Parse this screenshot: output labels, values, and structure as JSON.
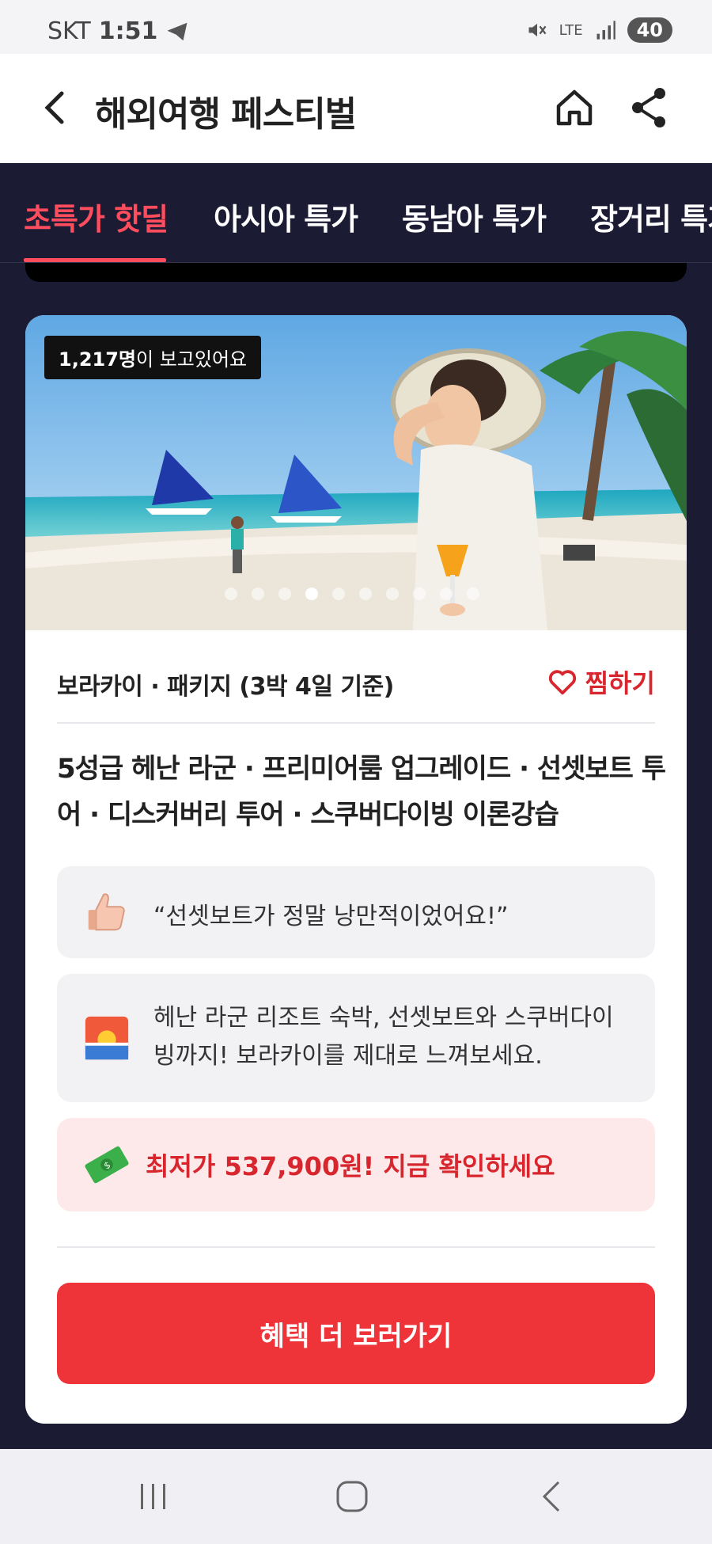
{
  "status_bar": {
    "carrier": "SKT",
    "time": "1:51",
    "network": "LTE",
    "battery": "40"
  },
  "header": {
    "title": "해외여행 페스티벌"
  },
  "tabs": [
    {
      "label": "초특가 핫딜",
      "active": true
    },
    {
      "label": "아시아 특가",
      "active": false
    },
    {
      "label": "동남아 특가",
      "active": false
    },
    {
      "label": "장거리 특가",
      "active": false
    }
  ],
  "card": {
    "viewers_count": "1,217명",
    "viewers_suffix": "이 보고있어요",
    "carousel": {
      "total": 10,
      "active_index": 3
    },
    "product_name": "보라카이 · 패키지 (3박 4일 기준)",
    "wishlist_label": "찜하기",
    "highlights": "5성급 헤난 라군 · 프리미어룸 업그레이드 · 선셋보트 투어 · 디스커버리 투어 · 스쿠버다이빙 이론강습",
    "review_quote": "“선셋보트가 정말 낭만적이었어요!”",
    "description": "헤난 라군 리조트 숙박, 선셋보트와 스쿠버다이빙까지! 보라카이를 제대로 느껴보세요.",
    "price_text": "최저가 537,900원! 지금 확인하세요",
    "cta_label": "혜택 더 보러가기"
  },
  "colors": {
    "accent": "#ff4d5e",
    "cta": "#ee3339",
    "background": "#1c1b34",
    "price_bg": "#fde9ea"
  }
}
